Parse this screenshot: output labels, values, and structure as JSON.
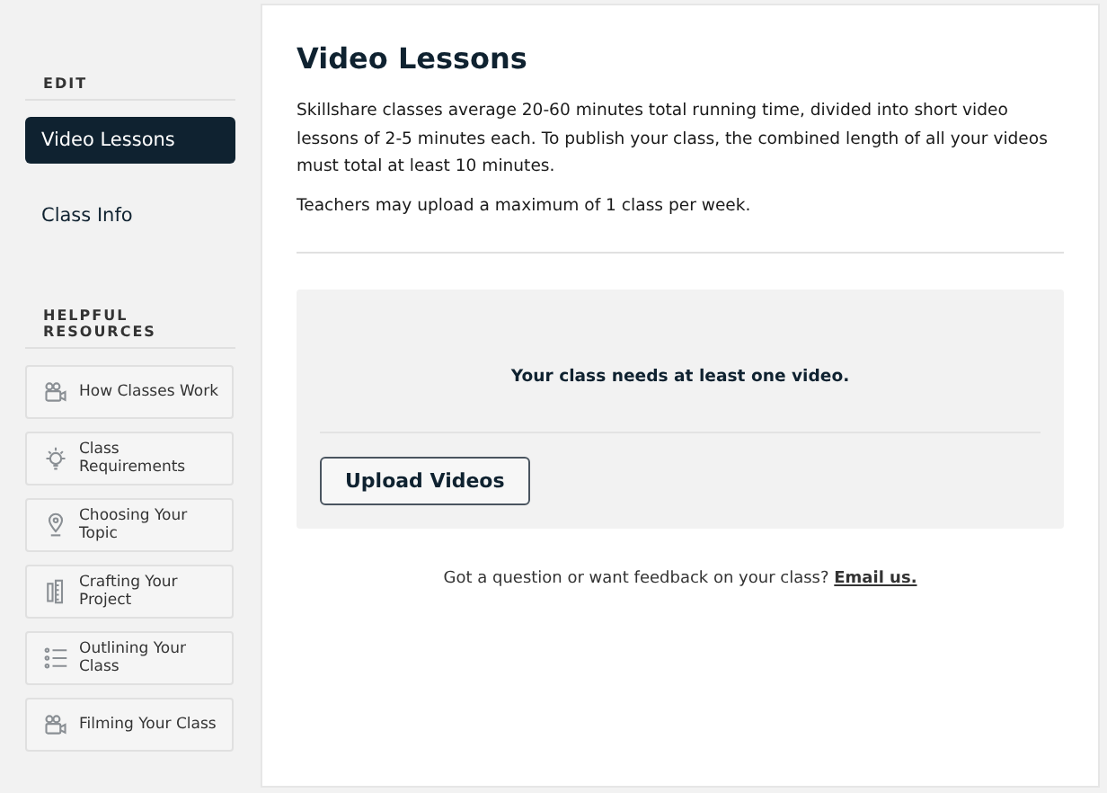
{
  "sidebar": {
    "edit_heading": "EDIT",
    "nav": [
      {
        "label": "Video Lessons",
        "selected": true
      },
      {
        "label": "Class Info",
        "selected": false
      }
    ],
    "resources_heading": "HELPFUL RESOURCES",
    "resources": [
      {
        "label": "How Classes Work",
        "kind": "camera"
      },
      {
        "label": "Class Requirements",
        "kind": "bulb"
      },
      {
        "label": "Choosing Your Topic",
        "kind": "pin"
      },
      {
        "label": "Crafting Your Project",
        "kind": "ruler"
      },
      {
        "label": "Outlining Your Class",
        "kind": "list"
      },
      {
        "label": "Filming Your Class",
        "kind": "camera"
      }
    ]
  },
  "main": {
    "title": "Video Lessons",
    "paragraphs": [
      "Skillshare classes average 20-60 minutes total running time, divided into short video lessons of 2-5 minutes each. To publish your class, the combined length of all your videos must total at least 10 minutes.",
      "Teachers may upload a maximum of 1 class per week."
    ],
    "upload_card": {
      "message": "Your class needs at least one video.",
      "button": "Upload Videos"
    },
    "feedback": {
      "text": "Got a question or want feedback on your class?",
      "link": "Email us."
    }
  }
}
